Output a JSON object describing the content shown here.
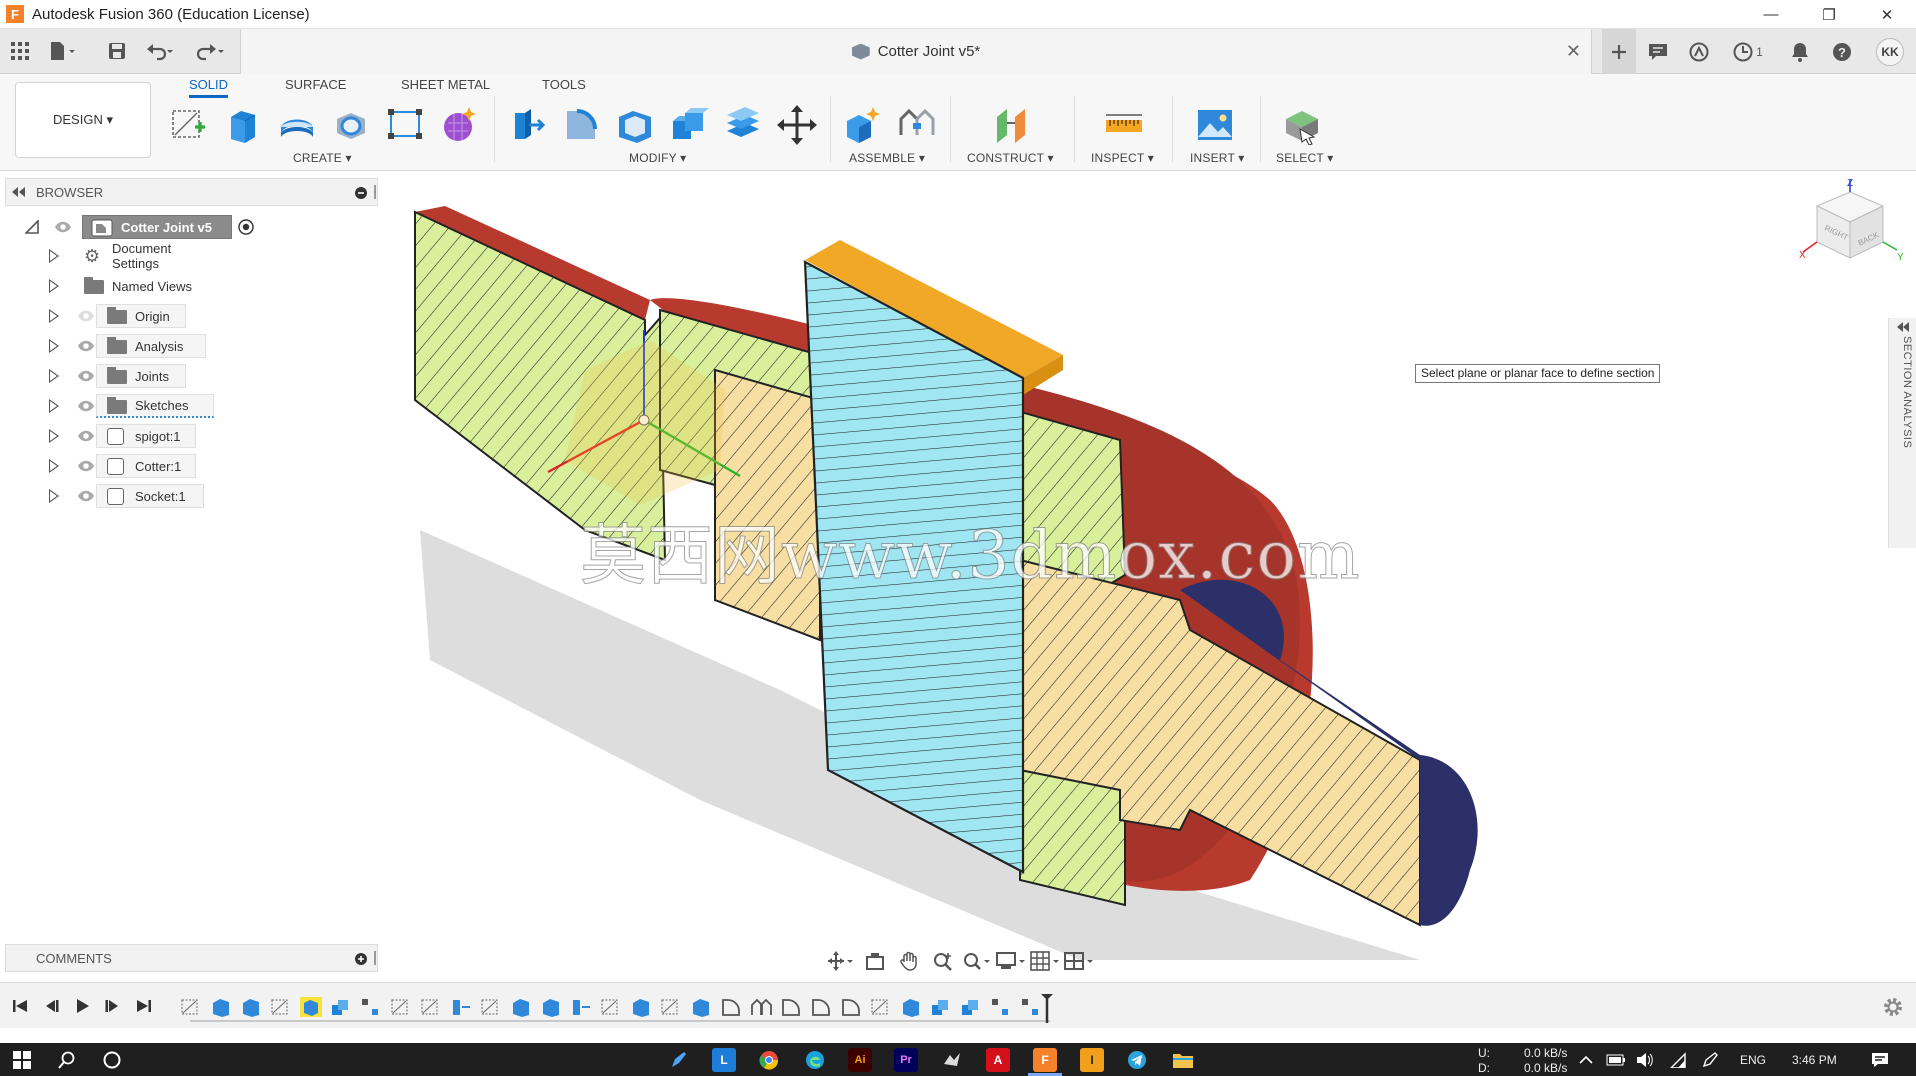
{
  "window": {
    "title": "Autodesk Fusion 360 (Education License)",
    "logo_letter": "F",
    "minimize": "—",
    "restore": "❐",
    "close": "✕"
  },
  "doc_tab": {
    "title": "Cotter Joint v5*",
    "close": "✕"
  },
  "top_right": {
    "job_count": "1",
    "avatar": "KK"
  },
  "ribbon": {
    "workspace": "DESIGN ▾",
    "tabs": [
      "SOLID",
      "SURFACE",
      "SHEET METAL",
      "TOOLS"
    ],
    "active_tab": "SOLID",
    "groups": [
      "CREATE ▾",
      "MODIFY ▾",
      "ASSEMBLE ▾",
      "CONSTRUCT ▾",
      "INSPECT ▾",
      "INSERT ▾",
      "SELECT ▾"
    ]
  },
  "browser": {
    "title": "BROWSER",
    "root": "Cotter Joint v5",
    "items": [
      "Document Settings",
      "Named Views",
      "Origin",
      "Analysis",
      "Joints",
      "Sketches",
      "spigot:1",
      "Cotter:1",
      "Socket:1"
    ]
  },
  "comments": {
    "title": "COMMENTS"
  },
  "viewport": {
    "tooltip": "Select plane or planar face to define section",
    "section_panel": "SECTION ANALYSIS",
    "watermark": "莫西网www.3dmox.com",
    "viewcube": {
      "top": "Z",
      "x": "X",
      "y": "Y",
      "right": "RIGHT",
      "back": "BACK"
    }
  },
  "taskbar": {
    "net_up_label": "U:",
    "net_down_label": "D:",
    "net_up": "0.0 kB/s",
    "net_down": "0.0 kB/s",
    "lang": "ENG",
    "time": "3:46 PM"
  },
  "colors": {
    "accent": "#0d66c2",
    "socket_red": "#b83a2f",
    "spigot_navy": "#2b3068",
    "cotter_orange": "#f0a826",
    "hatch_yellow": "#f7dfa3",
    "hatch_green": "#d8ef9c",
    "hatch_cyan": "#9fe6f2"
  }
}
